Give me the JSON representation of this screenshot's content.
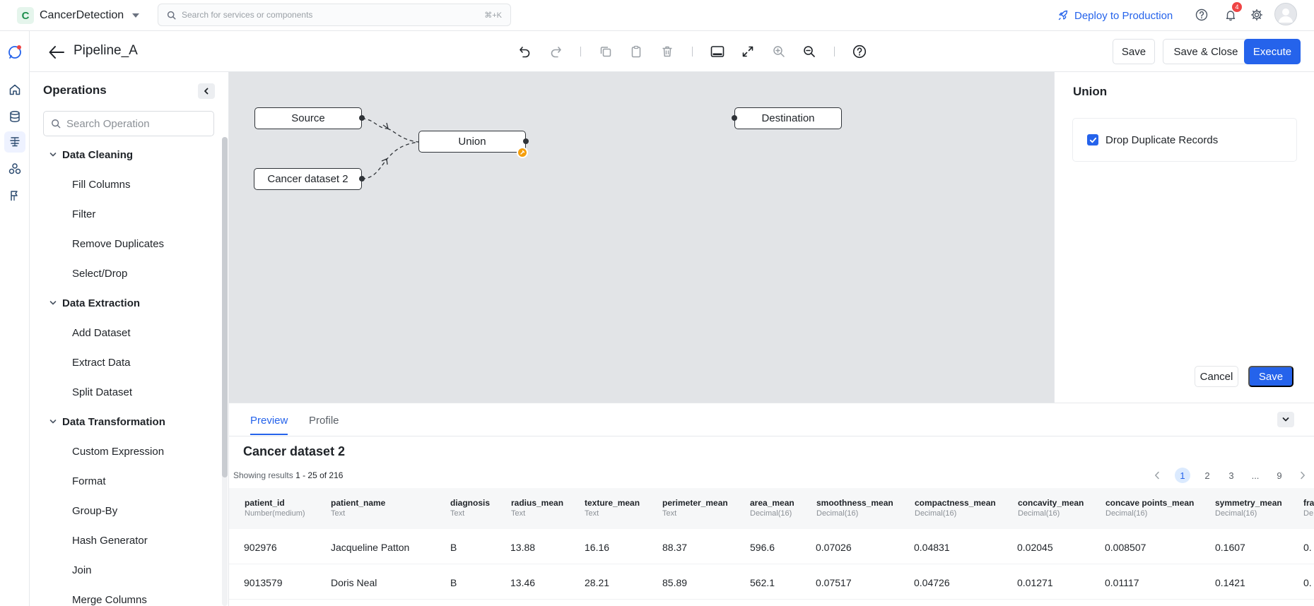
{
  "topbar": {
    "app_initial": "C",
    "app_name": "CancerDetection",
    "search_placeholder": "Search for services or components",
    "search_shortcut": "⌘+K",
    "deploy_label": "Deploy to Production",
    "notification_count": "4"
  },
  "pipeline": {
    "title": "Pipeline_A",
    "save_label": "Save",
    "save_close_label": "Save & Close",
    "execute_label": "Execute"
  },
  "operations": {
    "title": "Operations",
    "search_placeholder": "Search Operation",
    "groups": [
      {
        "label": "Data Cleaning",
        "items": [
          "Fill Columns",
          "Filter",
          "Remove Duplicates",
          "Select/Drop"
        ]
      },
      {
        "label": "Data Extraction",
        "items": [
          "Add Dataset",
          "Extract Data",
          "Split Dataset"
        ]
      },
      {
        "label": "Data Transformation",
        "items": [
          "Custom Expression",
          "Format",
          "Group-By",
          "Hash Generator",
          "Join",
          "Merge Columns"
        ]
      }
    ]
  },
  "canvas": {
    "nodes": {
      "source": "Source",
      "cancer_dataset_2": "Cancer dataset 2",
      "union": "Union",
      "destination": "Destination"
    }
  },
  "config": {
    "title": "Union",
    "drop_duplicates_label": "Drop Duplicate Records",
    "drop_duplicates_checked": true,
    "cancel_label": "Cancel",
    "save_label": "Save"
  },
  "preview": {
    "tabs": [
      "Preview",
      "Profile"
    ],
    "active_tab": "Preview",
    "dataset_title": "Cancer dataset 2",
    "results_prefix": "Showing results",
    "results_range": "1 - 25",
    "results_of": "of 216",
    "pages": [
      "1",
      "2",
      "3",
      "...",
      "9"
    ],
    "active_page": "1",
    "columns": [
      {
        "name": "patient_id",
        "type": "Number(medium)"
      },
      {
        "name": "patient_name",
        "type": "Text"
      },
      {
        "name": "diagnosis",
        "type": "Text"
      },
      {
        "name": "radius_mean",
        "type": "Text"
      },
      {
        "name": "texture_mean",
        "type": "Text"
      },
      {
        "name": "perimeter_mean",
        "type": "Text"
      },
      {
        "name": "area_mean",
        "type": "Decimal(16)"
      },
      {
        "name": "smoothness_mean",
        "type": "Decimal(16)"
      },
      {
        "name": "compactness_mean",
        "type": "Decimal(16)"
      },
      {
        "name": "concavity_mean",
        "type": "Decimal(16)"
      },
      {
        "name": "concave points_mean",
        "type": "Decimal(16)"
      },
      {
        "name": "symmetry_mean",
        "type": "Decimal(16)"
      },
      {
        "name": "fra",
        "type": "De"
      }
    ],
    "rows": [
      [
        "902976",
        "Jacqueline Patton",
        "B",
        "13.88",
        "16.16",
        "88.37",
        "596.6",
        "0.07026",
        "0.04831",
        "0.02045",
        "0.008507",
        "0.1607",
        "0."
      ],
      [
        "9013579",
        "Doris Neal",
        "B",
        "13.46",
        "28.21",
        "85.89",
        "562.1",
        "0.07517",
        "0.04726",
        "0.01271",
        "0.01117",
        "0.1421",
        "0."
      ]
    ]
  },
  "colors": {
    "accent": "#2563eb",
    "warning": "#f59e0b",
    "danger": "#ef4444"
  }
}
